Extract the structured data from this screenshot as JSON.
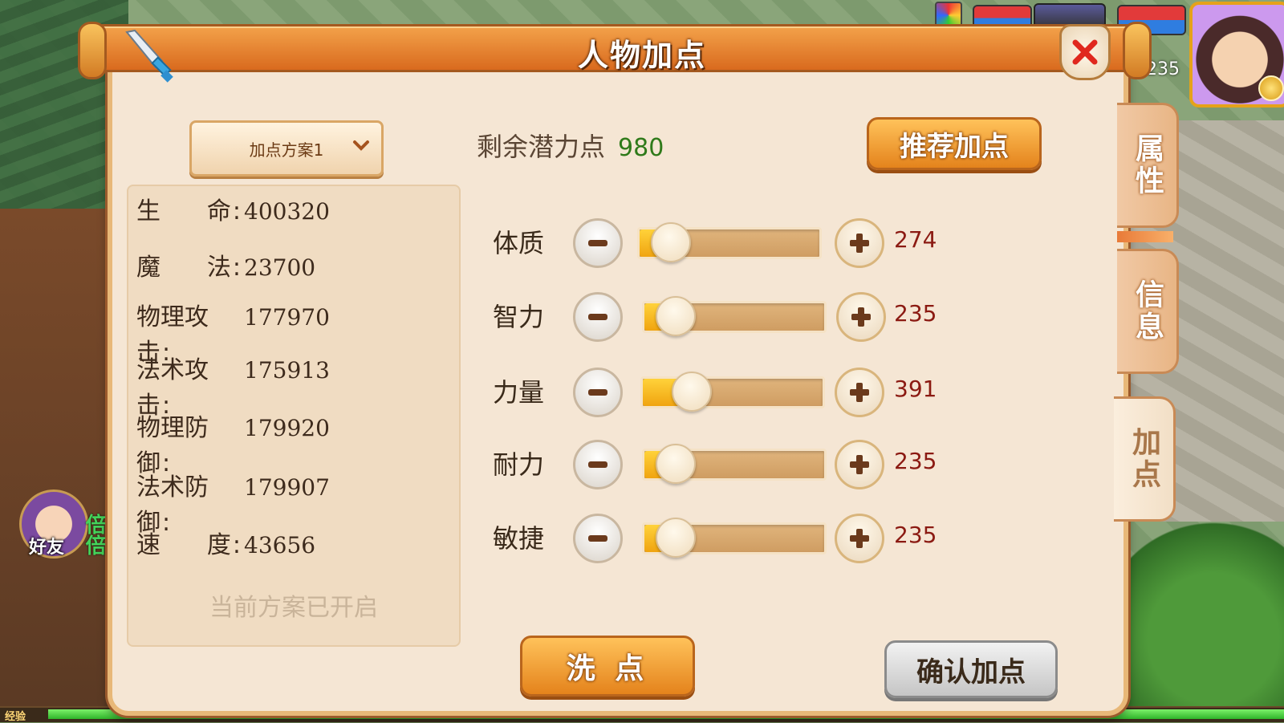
{
  "window": {
    "title": "人物加点"
  },
  "hud": {
    "level": "235"
  },
  "scheme": {
    "label": "加点方案1",
    "status": "当前方案已开启"
  },
  "stats": [
    {
      "label_a": "生",
      "label_b": "命",
      "value": "400320"
    },
    {
      "label_a": "魔",
      "label_b": "法",
      "value": "23700"
    },
    {
      "label_a": "物理攻击",
      "label_b": "",
      "value": "177970"
    },
    {
      "label_a": "法术攻击",
      "label_b": "",
      "value": "175913"
    },
    {
      "label_a": "物理防御",
      "label_b": "",
      "value": "179920"
    },
    {
      "label_a": "法术防御",
      "label_b": "",
      "value": "179907"
    },
    {
      "label_a": "速",
      "label_b": "度",
      "value": "43656"
    }
  ],
  "potential": {
    "label": "剩余潜力点",
    "value": "980"
  },
  "buttons": {
    "recommend": "推荐加点",
    "reset": "洗 点",
    "confirm": "确认加点"
  },
  "attributes": [
    {
      "name": "体质",
      "value": "274",
      "level": 0.07
    },
    {
      "name": "智力",
      "value": "235",
      "level": 0.04
    },
    {
      "name": "力量",
      "value": "391",
      "level": 0.17
    },
    {
      "name": "耐力",
      "value": "235",
      "level": 0.04
    },
    {
      "name": "敏捷",
      "value": "235",
      "level": 0.04
    }
  ],
  "side_tabs": [
    {
      "label": "属性",
      "active": false
    },
    {
      "label": "信息",
      "active": false
    },
    {
      "label": "加点",
      "active": true
    }
  ],
  "social": {
    "friend": "好友",
    "double": "倍倍"
  },
  "exp": {
    "label": "经验"
  },
  "colors": {
    "accent_orange": "#e4831c",
    "value_red": "#8b1a12",
    "potential_green": "#2f7a1a"
  }
}
